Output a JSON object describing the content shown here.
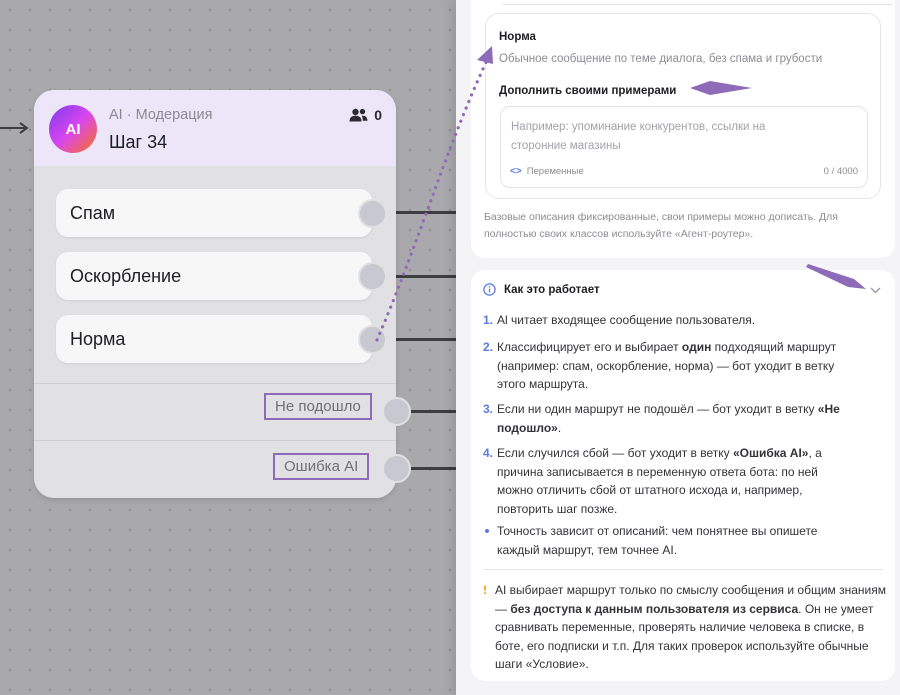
{
  "node": {
    "avatar": "AI",
    "type": "AI · Модерация",
    "title": "Шаг 34",
    "users_count": "0",
    "routes": [
      "Спам",
      "Оскорбление",
      "Норма"
    ],
    "fallback_not_matched": "Не подошло",
    "fallback_error": "Ошибка AI"
  },
  "class_card": {
    "name": "Норма",
    "description": "Обычное сообщение по теме диалога, без спама и грубости",
    "examples_label": "Дополнить своими примерами",
    "examples_placeholder": "Например: упоминание конкурентов, ссылки на сторонние магазины",
    "variables_label": "Переменные",
    "counter": "0 / 4000"
  },
  "hint": "Базовые описания фиксированные, свои примеры можно дописать. Для полностью своих классов используйте «Агент-роутер».",
  "how": {
    "title": "Как это работает",
    "steps": [
      {
        "num": "1.",
        "parts": [
          [
            "Al читает входящее сообщение пользователя.",
            false
          ]
        ]
      },
      {
        "num": "2.",
        "parts": [
          [
            "Классифицирует его и выбирает ",
            false
          ],
          [
            "один",
            true
          ],
          [
            " подходящий маршрут (например: спам, оскорбление, норма) — бот уходит в ветку этого маршрута.",
            false
          ]
        ]
      },
      {
        "num": "3.",
        "parts": [
          [
            "Если ни один маршрут не подошёл — бот уходит в ветку ",
            false
          ],
          [
            "«Не подошло»",
            true
          ],
          [
            ".",
            false
          ]
        ]
      },
      {
        "num": "4.",
        "parts": [
          [
            "Если случился сбой — бот уходит в ветку ",
            false
          ],
          [
            "«Ошибка AI»",
            true
          ],
          [
            ", а причина записывается в переменную ответа бота: по ней можно отличить сбой от штатного исхода и, например, повторить шаг позже.",
            false
          ]
        ]
      }
    ],
    "bullet": "Точность зависит от описаний: чем понятнее вы опишете каждый маршрут, тем точнее AI.",
    "warning_mark": "!",
    "warning_parts": [
      [
        "AI выбирает маршрут только по смыслу сообщения и общим знаниям — ",
        false
      ],
      [
        "без доступа к данным пользователя из сервиса",
        true
      ],
      [
        ". Он не умеет сравнивать переменные, проверять наличие человека в списке, в боте, его подписки и т.п. Для таких проверок используйте обычные шаги «Условие».",
        false
      ]
    ]
  },
  "colors": {
    "accent": "#8e6bb8",
    "link": "#5a7de0",
    "warning": "#f59e0b"
  }
}
